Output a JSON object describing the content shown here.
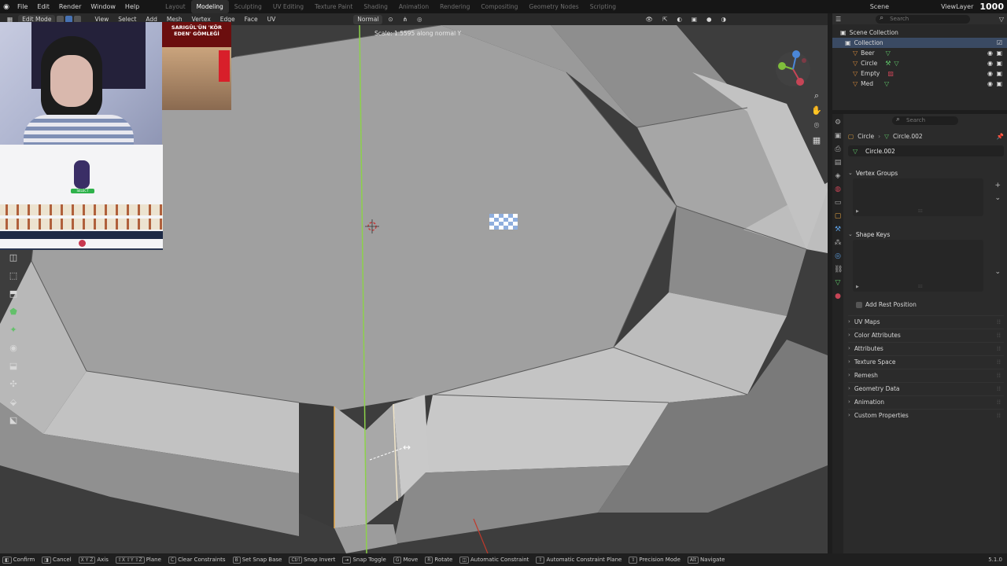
{
  "menu": {
    "items": [
      "File",
      "Edit",
      "Render",
      "Window",
      "Help"
    ],
    "workspaces": [
      "Layout",
      "Modeling",
      "Sculpting",
      "UV Editing",
      "Texture Paint",
      "Shading",
      "Animation",
      "Rendering",
      "Compositing",
      "Geometry Nodes",
      "Scripting"
    ],
    "active_workspace": "Modeling",
    "scene": "Scene",
    "view_layer": "ViewLayer",
    "counter": "1000"
  },
  "viewport_header": {
    "mode": "Edit Mode",
    "items": [
      "View",
      "Select",
      "Add",
      "Mesh",
      "Vertex",
      "Edge",
      "Face",
      "UV"
    ],
    "orientation": "Normal"
  },
  "operator": {
    "scale_label": "Scale: 1.5595 along normal Y"
  },
  "overlays": {
    "news_title": "SARIGÜL'ÜN 'KÖR EDEN' GÖMLEĞİ",
    "game_select": "SELECT"
  },
  "outliner": {
    "search_placeholder": "Search",
    "root": "Scene Collection",
    "collection": "Collection",
    "objects": [
      {
        "name": "Beer"
      },
      {
        "name": "Circle"
      },
      {
        "name": "Empty"
      },
      {
        "name": "Med"
      }
    ]
  },
  "properties": {
    "search_placeholder": "Search",
    "object": "Circle",
    "mesh": "Circle.002",
    "panels": {
      "vertex_groups": "Vertex Groups",
      "shape_keys": "Shape Keys",
      "add_rest_position": "Add Rest Position",
      "uv_maps": "UV Maps",
      "color_attributes": "Color Attributes",
      "attributes": "Attributes",
      "texture_space": "Texture Space",
      "remesh": "Remesh",
      "geometry_data": "Geometry Data",
      "animation": "Animation",
      "custom_properties": "Custom Properties"
    }
  },
  "status_bar": {
    "hints": [
      {
        "key": "",
        "label": "Confirm"
      },
      {
        "key": "",
        "label": "Cancel"
      },
      {
        "key": "X Y Z",
        "label": "Axis"
      },
      {
        "key": "⇧X ⇧Y ⇧Z",
        "label": "Plane"
      },
      {
        "key": "C",
        "label": "Clear Constraints"
      },
      {
        "key": "B",
        "label": "Set Snap Base"
      },
      {
        "key": "Ctrl",
        "label": "Snap Invert"
      },
      {
        "key": "",
        "label": "Snap Toggle"
      },
      {
        "key": "G",
        "label": "Move"
      },
      {
        "key": "R",
        "label": "Rotate"
      },
      {
        "key": "",
        "label": "Automatic Constraint"
      },
      {
        "key": "",
        "label": "Automatic Constraint Plane"
      },
      {
        "key": "",
        "label": "Precision Mode"
      },
      {
        "key": "Alt",
        "label": "Navigate"
      }
    ],
    "version": "5.1.0"
  }
}
